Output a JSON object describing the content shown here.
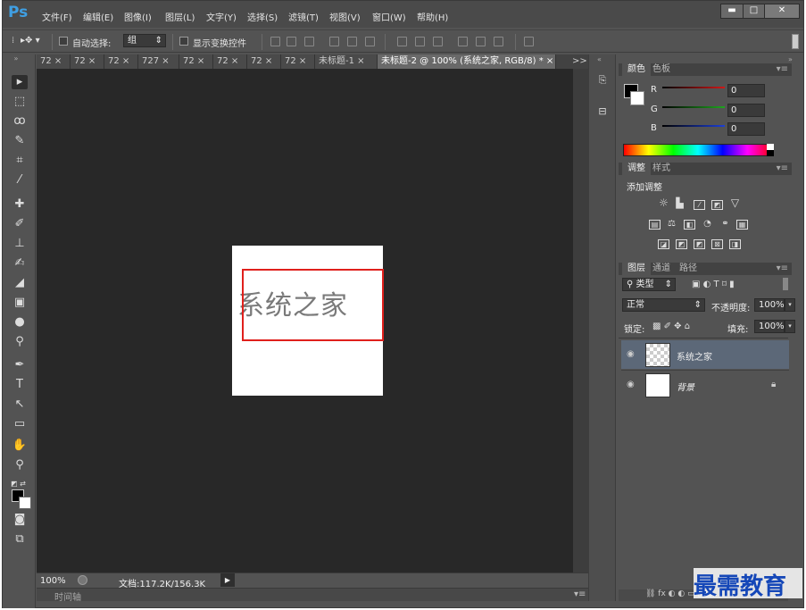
{
  "app": {
    "logo": "Ps"
  },
  "menu": [
    "文件(F)",
    "编辑(E)",
    "图像(I)",
    "图层(L)",
    "文字(Y)",
    "选择(S)",
    "滤镜(T)",
    "视图(V)",
    "窗口(W)",
    "帮助(H)"
  ],
  "window_controls": {
    "minimize": "▬",
    "maximize": "□",
    "close": "✕"
  },
  "options": {
    "auto_select_label": "自动选择:",
    "auto_select_value": "组",
    "show_transform_label": "显示变换控件"
  },
  "tabs": [
    {
      "label": "72",
      "close": "×"
    },
    {
      "label": "72",
      "close": "×"
    },
    {
      "label": "72",
      "close": "×"
    },
    {
      "label": "727",
      "close": "×"
    },
    {
      "label": "72",
      "close": "×"
    },
    {
      "label": "72",
      "close": "×"
    },
    {
      "label": "72",
      "close": "×"
    },
    {
      "label": "72",
      "close": "×"
    },
    {
      "label": "未标题-1",
      "close": "×"
    },
    {
      "label": "未标题-2 @ 100% (系统之家, RGB/8) *",
      "close": "×"
    }
  ],
  "tab_overflow": ">>",
  "document": {
    "text": "系统之家"
  },
  "status": {
    "zoom": "100%",
    "doc_info": "文档:117.2K/156.3K",
    "timeline": "时间轴"
  },
  "color_panel": {
    "tabs": [
      "颜色",
      "色板"
    ],
    "channels": [
      {
        "label": "R",
        "value": "0",
        "color": "#d01818"
      },
      {
        "label": "G",
        "value": "0",
        "color": "#1ea61e"
      },
      {
        "label": "B",
        "value": "0",
        "color": "#1c3fd8"
      }
    ]
  },
  "adjustments_panel": {
    "tabs": [
      "调整",
      "样式"
    ],
    "title": "添加调整"
  },
  "layers_panel": {
    "tabs": [
      "图层",
      "通道",
      "路径"
    ],
    "filter_kind": "类型",
    "blend_mode": "正常",
    "opacity_label": "不透明度:",
    "opacity_value": "100%",
    "lock_label": "锁定:",
    "fill_label": "填充:",
    "fill_value": "100%",
    "layers": [
      {
        "name": "系统之家",
        "selected": true
      },
      {
        "name": "背景",
        "selected": false
      }
    ]
  },
  "watermark": "最需教育"
}
